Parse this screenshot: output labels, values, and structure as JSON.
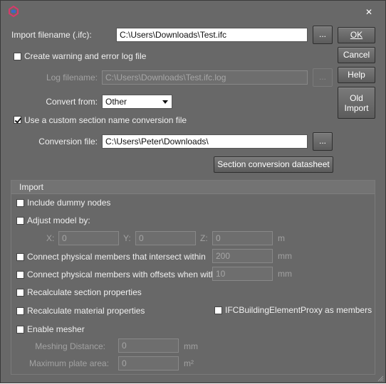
{
  "titlebar": {
    "close_glyph": "✕"
  },
  "import_filename": {
    "label": "Import filename (.ifc):",
    "value": "C:\\Users\\Downloads\\Test.ifc",
    "browse": "..."
  },
  "log_checkbox": {
    "label": "Create warning and error log file",
    "checked": false
  },
  "log_filename": {
    "label": "Log filename:",
    "value": "C:\\Users\\Downloads\\Test.ifc.log",
    "browse": "..."
  },
  "convert_from": {
    "label": "Convert from:",
    "value": "Other"
  },
  "custom_section_checkbox": {
    "label": "Use a custom section name conversion file",
    "checked": true
  },
  "conversion_file": {
    "label": "Conversion file:",
    "value": "C:\\Users\\Peter\\Downloads\\",
    "browse": "..."
  },
  "section_datasheet_button": "Section conversion datasheet",
  "buttons": {
    "ok": "OK",
    "cancel": "Cancel",
    "help": "Help",
    "old_import_line1": "Old",
    "old_import_line2": "Import"
  },
  "import_group": {
    "title": "Import",
    "include_dummy_nodes": "Include dummy nodes",
    "adjust_model_by": "Adjust model by:",
    "x_label": "X:",
    "x_value": "0",
    "y_label": "Y:",
    "y_value": "0",
    "z_label": "Z:",
    "z_value": "0",
    "adjust_unit": "m",
    "connect_intersect": "Connect physical members that intersect within",
    "connect_intersect_value": "200",
    "connect_intersect_unit": "mm",
    "connect_offsets": "Connect physical members with offsets when within",
    "connect_offsets_value": "10",
    "connect_offsets_unit": "mm",
    "recalc_section": "Recalculate section properties",
    "recalc_material": "Recalculate material properties",
    "ifc_proxy": "IFCBuildingElementProxy as members",
    "enable_mesher": "Enable mesher",
    "meshing_distance_label": "Meshing Distance:",
    "meshing_distance_value": "0",
    "meshing_distance_unit": "mm",
    "max_plate_area_label": "Maximum plate area:",
    "max_plate_area_value": "0",
    "max_plate_area_unit": "m²"
  }
}
